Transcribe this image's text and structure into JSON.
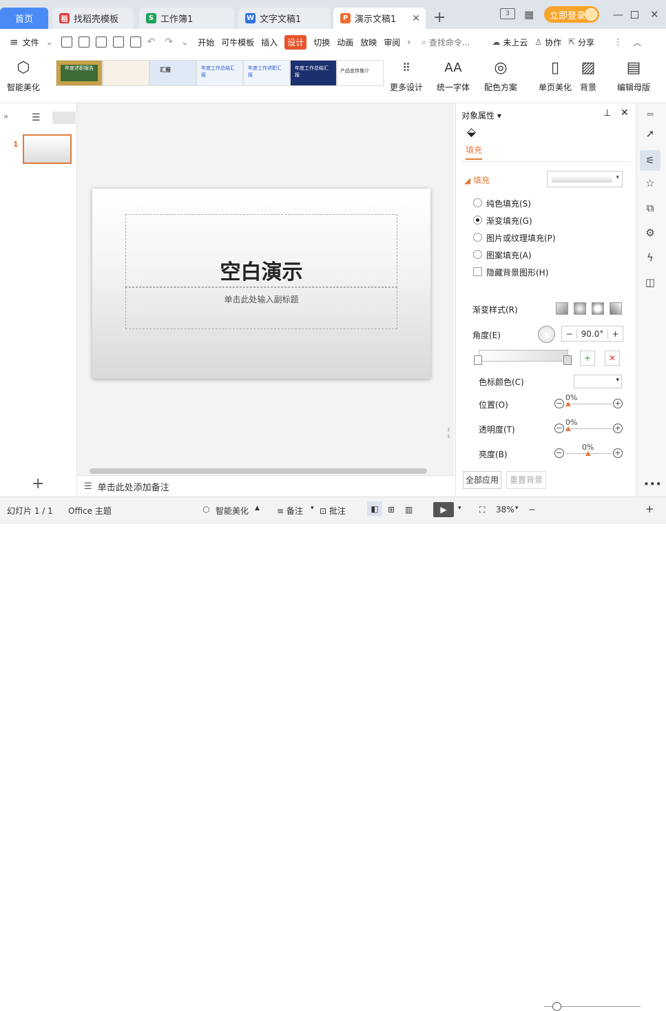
{
  "tabs": {
    "home": "首页",
    "doc1": "找稻壳模板",
    "doc2": "工作簿1",
    "doc3": "文字文稿1",
    "doc4": "演示文稿1"
  },
  "header": {
    "login": "立即登录"
  },
  "menu": {
    "file": "文件",
    "items": [
      "开始",
      "可牛模板",
      "插入",
      "设计",
      "切换",
      "动画",
      "放映",
      "审阅"
    ],
    "search_placeholder": "查找命令...",
    "cloud": "未上云",
    "collab": "协作",
    "share": "分享"
  },
  "ribbon": {
    "smart_beautify": "智能美化",
    "more_design": "更多设计",
    "unify_font": "统一字体",
    "color_scheme": "配色方案",
    "single_page": "单页美化",
    "background": "背景",
    "edit_master": "编辑母版",
    "thumbs": [
      "年度述职报告",
      "",
      "汇报",
      "年度工作总结汇报",
      "年度工作述职汇报",
      "年度工作总结汇报",
      "产品宣传推介"
    ]
  },
  "slides": {
    "number": "1"
  },
  "slide": {
    "title": "空白演示",
    "subtitle": "单击此处输入副标题"
  },
  "notes": "单击此处添加备注",
  "panel": {
    "title": "对象属性",
    "tab": "填充",
    "fill_section": "填充",
    "options": [
      "纯色填充(S)",
      "渐变填充(G)",
      "图片或纹理填充(P)",
      "图案填充(A)"
    ],
    "hide_bg": "隐藏背景图形(H)",
    "gradient_style": "渐变样式(R)",
    "angle_label": "角度(E)",
    "angle_value": "90.0°",
    "stop_color": "色标颜色(C)",
    "position": "位置(O)",
    "position_value": "0%",
    "transparency": "透明度(T)",
    "transparency_value": "0%",
    "brightness": "亮度(B)",
    "brightness_value": "0%",
    "apply_all": "全部应用",
    "reset_bg": "重置背景"
  },
  "status": {
    "slide_count": "幻灯片 1 / 1",
    "theme": "Office 主题",
    "smart": "智能美化",
    "notes": "备注",
    "comment": "批注",
    "zoom": "38%"
  }
}
